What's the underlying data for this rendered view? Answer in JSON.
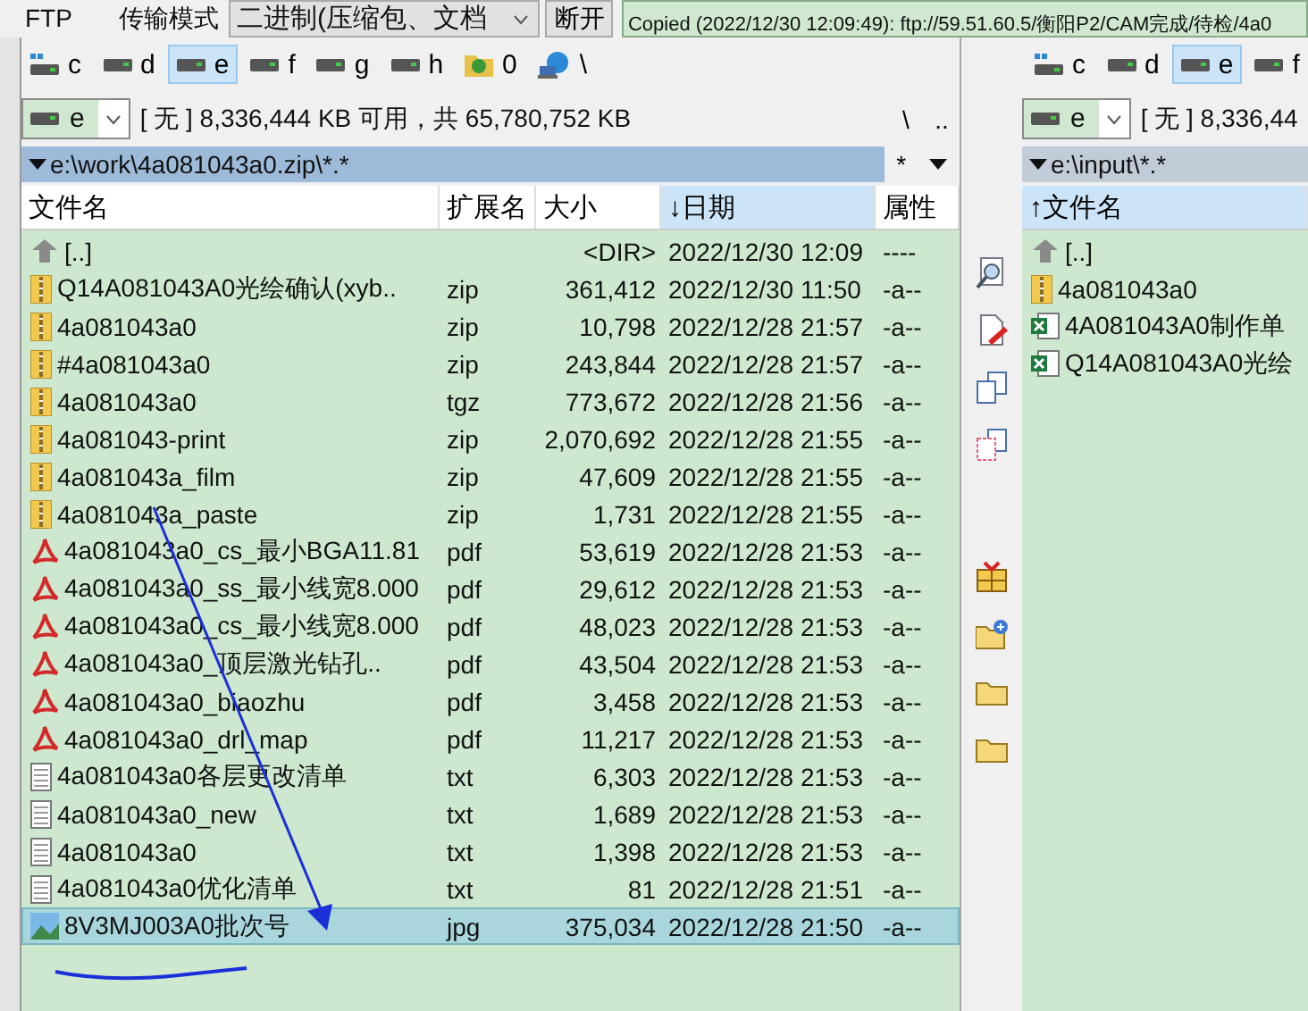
{
  "toolbar": {
    "ftp_label": "FTP",
    "transfer_mode_label": "传输模式",
    "transfer_mode": "二进制(压缩包、文档",
    "disconnect_button": "断开",
    "log": "Copied (2022/12/30 12:09:49): ftp://59.51.60.5/衡阳P2/CAM完成/待检/4a0"
  },
  "left_panel": {
    "drives": [
      {
        "letter": "c",
        "kind": "system",
        "selected": false
      },
      {
        "letter": "d",
        "kind": "drive",
        "selected": false
      },
      {
        "letter": "e",
        "kind": "drive",
        "selected": true
      },
      {
        "letter": "f",
        "kind": "drive",
        "selected": false
      },
      {
        "letter": "g",
        "kind": "drive",
        "selected": false
      },
      {
        "letter": "h",
        "kind": "drive",
        "selected": false
      },
      {
        "letter": "0",
        "kind": "ftp",
        "selected": false
      },
      {
        "letter": "\\",
        "kind": "network",
        "selected": false
      }
    ],
    "drive_combo": "e",
    "free_space": "[ 无 ]  8,336,444 KB 可用，共 65,780,752 KB",
    "root_button": "\\",
    "up_button": "..",
    "path": "e:\\work\\4a081043a0.zip\\*.*",
    "history_button": "*",
    "columns": [
      {
        "label": "文件名",
        "sorted": false
      },
      {
        "label": "扩展名",
        "sorted": false
      },
      {
        "label": "大小",
        "sorted": false
      },
      {
        "label": "日期",
        "sorted": true,
        "sort_arrow": "↓"
      },
      {
        "label": "属性",
        "sorted": false
      }
    ],
    "files": [
      {
        "kind": "up",
        "name": "[..]",
        "size": "<DIR>",
        "date": "2022/12/30 12:09",
        "attr": "----",
        "selected": false
      },
      {
        "kind": "archive",
        "name": "Q14A081043A0光绘确认(xyb..",
        "ext": "zip",
        "size": "361,412",
        "date": "2022/12/30 11:50",
        "attr": "-a--",
        "selected": false
      },
      {
        "kind": "archive",
        "name": "4a081043a0",
        "ext": "zip",
        "size": "10,798",
        "date": "2022/12/28 21:57",
        "attr": "-a--",
        "selected": false
      },
      {
        "kind": "archive",
        "name": "#4a081043a0",
        "ext": "zip",
        "size": "243,844",
        "date": "2022/12/28 21:57",
        "attr": "-a--",
        "selected": false
      },
      {
        "kind": "archive",
        "name": "4a081043a0",
        "ext": "tgz",
        "size": "773,672",
        "date": "2022/12/28 21:56",
        "attr": "-a--",
        "selected": false
      },
      {
        "kind": "archive",
        "name": "4a081043-print",
        "ext": "zip",
        "size": "2,070,692",
        "date": "2022/12/28 21:55",
        "attr": "-a--",
        "selected": false
      },
      {
        "kind": "archive",
        "name": "4a081043a_film",
        "ext": "zip",
        "size": "47,609",
        "date": "2022/12/28 21:55",
        "attr": "-a--",
        "selected": false
      },
      {
        "kind": "archive",
        "name": "4a081043a_paste",
        "ext": "zip",
        "size": "1,731",
        "date": "2022/12/28 21:55",
        "attr": "-a--",
        "selected": false
      },
      {
        "kind": "pdf",
        "name": "4a081043a0_cs_最小BGA11.81",
        "ext": "pdf",
        "size": "53,619",
        "date": "2022/12/28 21:53",
        "attr": "-a--",
        "selected": false
      },
      {
        "kind": "pdf",
        "name": "4a081043a0_ss_最小线宽8.000",
        "ext": "pdf",
        "size": "29,612",
        "date": "2022/12/28 21:53",
        "attr": "-a--",
        "selected": false
      },
      {
        "kind": "pdf",
        "name": "4a081043a0_cs_最小线宽8.000",
        "ext": "pdf",
        "size": "48,023",
        "date": "2022/12/28 21:53",
        "attr": "-a--",
        "selected": false
      },
      {
        "kind": "pdf",
        "name": "4a081043a0_顶层激光钻孔..",
        "ext": "pdf",
        "size": "43,504",
        "date": "2022/12/28 21:53",
        "attr": "-a--",
        "selected": false
      },
      {
        "kind": "pdf",
        "name": "4a081043a0_biaozhu",
        "ext": "pdf",
        "size": "3,458",
        "date": "2022/12/28 21:53",
        "attr": "-a--",
        "selected": false
      },
      {
        "kind": "pdf",
        "name": "4a081043a0_drl_map",
        "ext": "pdf",
        "size": "11,217",
        "date": "2022/12/28 21:53",
        "attr": "-a--",
        "selected": false
      },
      {
        "kind": "text",
        "name": "4a081043a0各层更改清单",
        "ext": "txt",
        "size": "6,303",
        "date": "2022/12/28 21:53",
        "attr": "-a--",
        "selected": false
      },
      {
        "kind": "text",
        "name": "4a081043a0_new",
        "ext": "txt",
        "size": "1,689",
        "date": "2022/12/28 21:53",
        "attr": "-a--",
        "selected": false
      },
      {
        "kind": "text",
        "name": "4a081043a0",
        "ext": "txt",
        "size": "1,398",
        "date": "2022/12/28 21:53",
        "attr": "-a--",
        "selected": false
      },
      {
        "kind": "text",
        "name": "4a081043a0优化清单",
        "ext": "txt",
        "size": "81",
        "date": "2022/12/28 21:51",
        "attr": "-a--",
        "selected": false
      },
      {
        "kind": "image",
        "name": "8V3MJ003A0批次号",
        "ext": "jpg",
        "size": "375,034",
        "date": "2022/12/28 21:50",
        "attr": "-a--",
        "selected": true
      }
    ]
  },
  "right_panel": {
    "drives": [
      {
        "letter": "c",
        "kind": "system",
        "selected": false
      },
      {
        "letter": "d",
        "kind": "drive",
        "selected": false
      },
      {
        "letter": "e",
        "kind": "drive",
        "selected": true
      },
      {
        "letter": "f",
        "kind": "drive",
        "selected": false
      }
    ],
    "drive_combo": "e",
    "free_space": "[ 无 ]  8,336,44",
    "path": "e:\\input\\*.*",
    "columns": [
      {
        "label": "文件名",
        "sorted": true,
        "sort_arrow": "↑"
      }
    ],
    "files": [
      {
        "kind": "up",
        "name": "[..]",
        "selected": false
      },
      {
        "kind": "archive",
        "name": "4a081043a0",
        "selected": false
      },
      {
        "kind": "sheet",
        "name": "4A081043A0制作单",
        "selected": false
      },
      {
        "kind": "sheet",
        "name": "Q14A081043A0光绘",
        "selected": false
      }
    ]
  },
  "button_bar": [
    {
      "kind": "view"
    },
    {
      "kind": "edit"
    },
    {
      "kind": "copy"
    },
    {
      "kind": "move"
    },
    {
      "kind": "gap"
    },
    {
      "kind": "pack"
    },
    {
      "kind": "newfolder"
    },
    {
      "kind": "folder"
    },
    {
      "kind": "folder"
    }
  ]
}
